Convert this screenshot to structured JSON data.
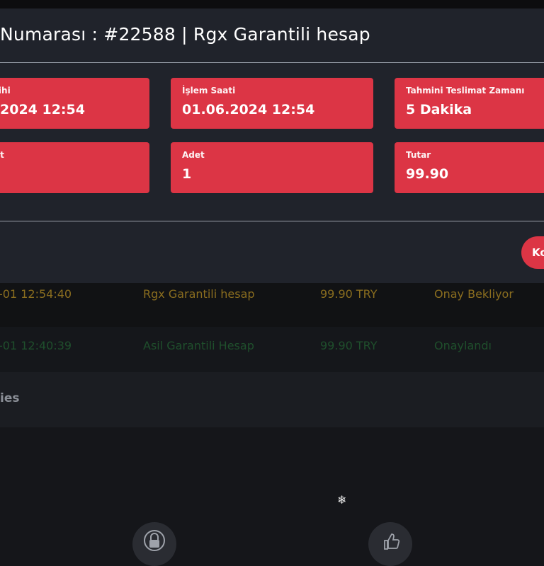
{
  "modal": {
    "title": "Numarası : #22588 | Rgx Garantili hesap",
    "cards": [
      {
        "label": "rihi",
        "value": "2024 12:54"
      },
      {
        "label": "İşlem Saati",
        "value": "01.06.2024 12:54"
      },
      {
        "label": "Tahmini Teslimat Zamanı",
        "value": "5 Dakika"
      },
      {
        "label": "at",
        "value": ""
      },
      {
        "label": "Adet",
        "value": "1"
      },
      {
        "label": "Tutar",
        "value": "99.90"
      }
    ],
    "button_label": "Ko"
  },
  "orders": [
    {
      "date": "-01 12:54:40",
      "product": "Rgx Garantili hesap",
      "price": "99.90 TRY",
      "status": "Onay Bekliyor",
      "status_color": "#8a6d1f"
    },
    {
      "date": "-01 12:40:39",
      "product": "Asil Garantili Hesap",
      "price": "99.90 TRY",
      "status": "Onaylandı",
      "status_color": "#1f4f2c"
    }
  ],
  "section": {
    "label": "ies"
  },
  "footer": {
    "snow_glyph": "❄",
    "left_icon": "lock-icon",
    "right_icon": "thumbs-up-icon"
  },
  "colors": {
    "accent": "#dc3545",
    "modal_bg": "#20232b",
    "page_bg": "#15161a"
  }
}
